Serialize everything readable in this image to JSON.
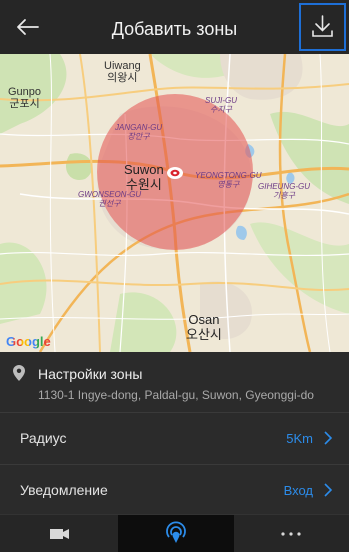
{
  "header": {
    "title": "Добавить зоны",
    "back_icon": "arrow-left-icon",
    "download_icon": "download-icon",
    "accent_color": "#1e6fd6"
  },
  "map": {
    "labels": {
      "gunpo": "Gunpo",
      "gunpo_kr": "군포시",
      "uiwang": "Uiwang",
      "uiwang_kr": "의왕시",
      "sujigu": "SUJI-GU",
      "sujigu_kr": "수지구",
      "jangangu": "JANGAN-GU",
      "jangangu_kr": "장안구",
      "suwon": "Suwon",
      "suwon_kr": "수원시",
      "yeongtong": "YEONGTONG-GU",
      "yeongtong_kr": "영통구",
      "gwonseon": "GWONSEON-GU",
      "gwonseon_kr": "권선구",
      "giheung": "GIHEUNG-GU",
      "giheung_kr": "기흥구",
      "osan": "Osan",
      "osan_kr": "오산시"
    },
    "attribution": "Google",
    "zone_color": "#e45050"
  },
  "zone_settings": {
    "title": "Настройки зоны",
    "address": "1130-1 Ingye-dong, Paldal-gu, Suwon, Gyeonggi-do",
    "icon": "location-pin-icon"
  },
  "settings": {
    "radius_label": "Радиус",
    "radius_value": "5Km",
    "notification_label": "Уведомление",
    "notification_value": "Вход",
    "value_color": "#2c8cea"
  },
  "tabbar": {
    "tabs": [
      "video-camera-icon",
      "geofence-icon",
      "more-icon"
    ],
    "active_tab": "geofence-icon"
  }
}
